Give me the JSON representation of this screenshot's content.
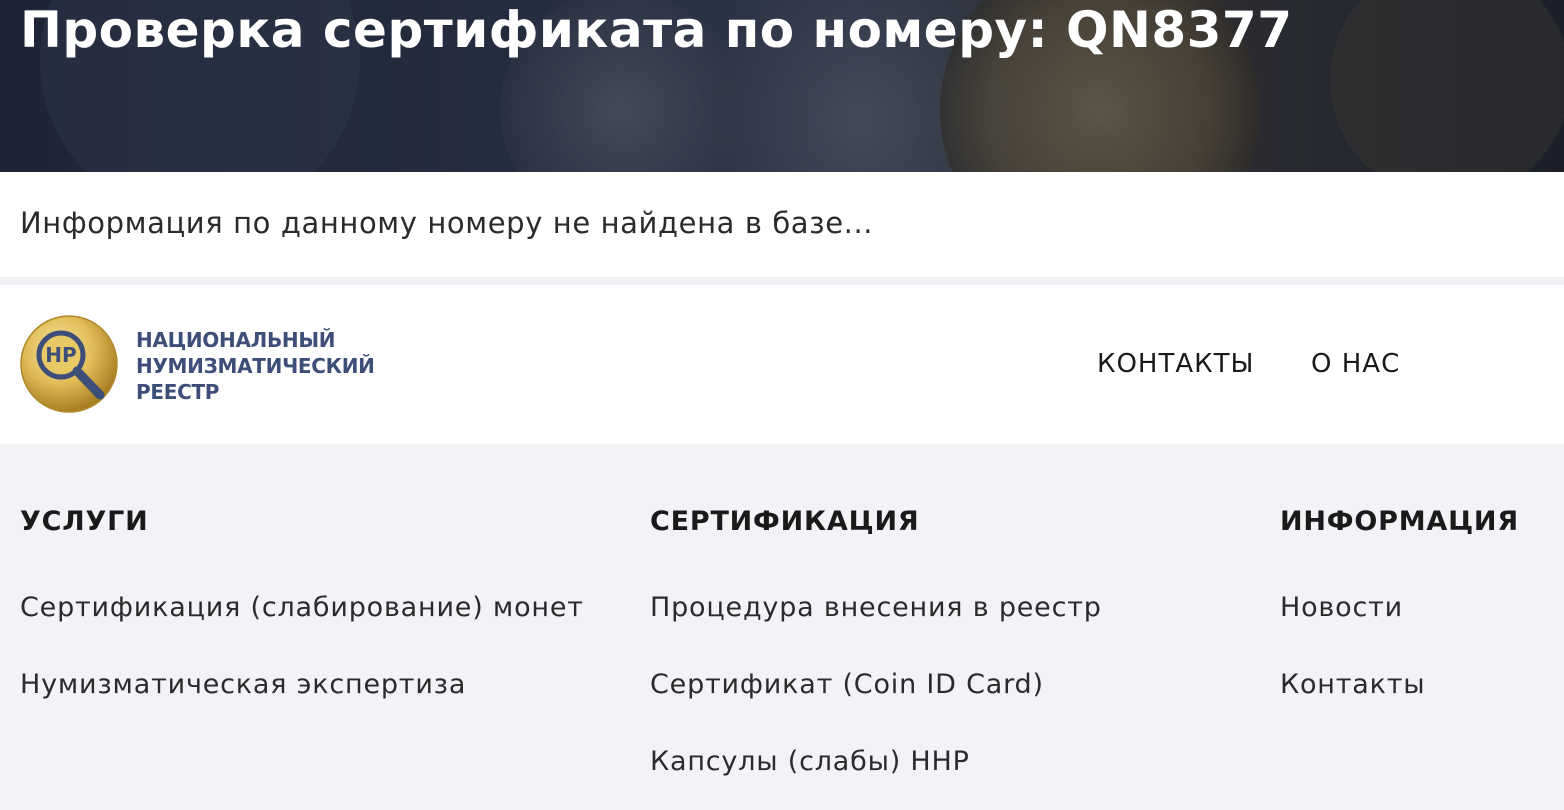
{
  "hero": {
    "title": "Проверка сертификата по номеру: QN8377"
  },
  "notice": {
    "message": "Информация по данному номеру не найдена в базе..."
  },
  "header": {
    "logo": {
      "icon_letters": "НР",
      "line1": "НАЦИОНАЛЬНЫЙ",
      "line2": "НУМИЗМАТИЧЕСКИЙ",
      "line3": "РЕЕСТР"
    },
    "nav": [
      {
        "label": "КОНТАКТЫ"
      },
      {
        "label": "О НАС"
      }
    ]
  },
  "footer": {
    "columns": [
      {
        "heading": "УСЛУГИ",
        "links": [
          "Сертификация (слабирование) монет",
          "Нумизматическая экспертиза"
        ]
      },
      {
        "heading": "СЕРТИФИКАЦИЯ",
        "links": [
          "Процедура внесения в реестр",
          "Сертификат (Coin ID Card)",
          "Капсулы (слабы) ННР"
        ]
      },
      {
        "heading": "ИНФОРМАЦИЯ",
        "links": [
          "Новости",
          "Контакты"
        ]
      }
    ]
  },
  "colors": {
    "logo_text": "#3d4e78",
    "footer_bg": "#f1f3f7",
    "hero_bg": "#2a3447"
  }
}
